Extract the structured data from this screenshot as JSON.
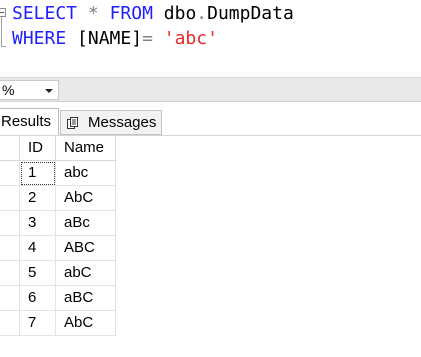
{
  "editor": {
    "line1": {
      "select": "SELECT",
      "star": "*",
      "from": "FROM",
      "schema": "dbo",
      "dot": ".",
      "table": "DumpData"
    },
    "line2": {
      "where": "WHERE",
      "column": "[NAME]",
      "eq": "=",
      "value": "'abc'"
    }
  },
  "toolbar": {
    "zoom_value": "%"
  },
  "tabs": {
    "results_label": "Results",
    "messages_label": "Messages"
  },
  "grid": {
    "columns": [
      "ID",
      "Name"
    ],
    "rows": [
      {
        "id": "1",
        "name": "abc"
      },
      {
        "id": "2",
        "name": "AbC"
      },
      {
        "id": "3",
        "name": "aBc"
      },
      {
        "id": "4",
        "name": "ABC"
      },
      {
        "id": "5",
        "name": "abC"
      },
      {
        "id": "6",
        "name": "aBC"
      },
      {
        "id": "7",
        "name": "AbC"
      }
    ]
  }
}
